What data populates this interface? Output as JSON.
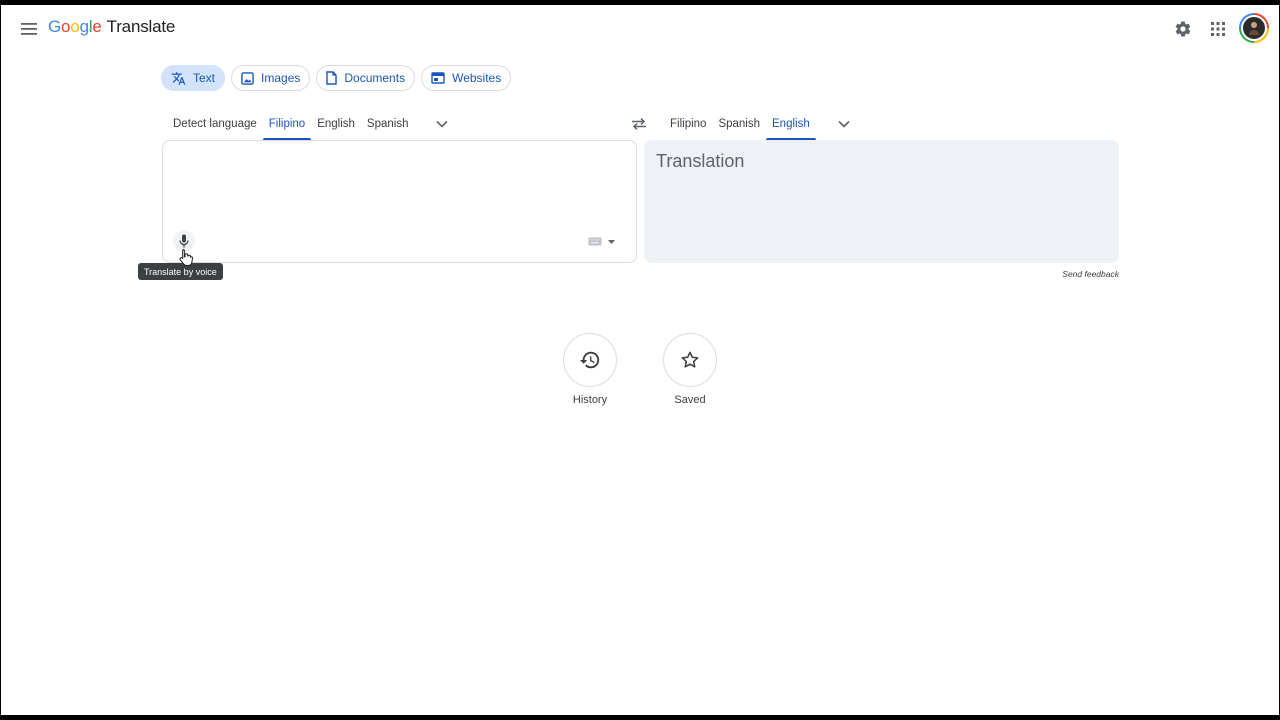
{
  "header": {
    "logo_letters": [
      "G",
      "o",
      "o",
      "g",
      "l",
      "e"
    ],
    "product": "Translate"
  },
  "modes": [
    {
      "label": "Text",
      "active": true
    },
    {
      "label": "Images",
      "active": false
    },
    {
      "label": "Documents",
      "active": false
    },
    {
      "label": "Websites",
      "active": false
    }
  ],
  "source_langs": [
    "Detect language",
    "Filipino",
    "English",
    "Spanish"
  ],
  "source_active": "Filipino",
  "target_langs": [
    "Filipino",
    "Spanish",
    "English"
  ],
  "target_active": "English",
  "source": {
    "value": ""
  },
  "target": {
    "placeholder": "Translation"
  },
  "tooltip": "Translate by voice",
  "send_feedback": "Send feedback",
  "quick": {
    "history": "History",
    "saved": "Saved"
  },
  "colors": {
    "accent": "#1a56b8",
    "active_chip": "#d3e3fd",
    "target_bg": "#eef2f7"
  },
  "icons": {
    "menu": "menu-icon",
    "settings": "gear-icon",
    "apps": "apps-grid-icon",
    "text": "translate-icon",
    "images": "image-icon",
    "documents": "document-icon",
    "websites": "web-icon",
    "swap": "swap-icon",
    "mic": "microphone-icon",
    "keyboard": "keyboard-icon",
    "history": "history-icon",
    "saved": "star-icon"
  }
}
